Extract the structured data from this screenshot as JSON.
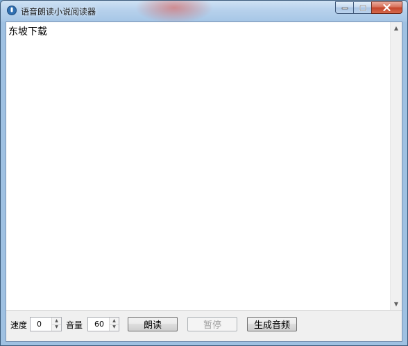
{
  "window": {
    "title": "语音朗读小说阅读器",
    "icon": "microphone-icon"
  },
  "editor": {
    "text": "东坡下载"
  },
  "controls": {
    "speed_label": "速度",
    "speed_value": "0",
    "volume_label": "音量",
    "volume_value": "60",
    "read_button": "朗读",
    "pause_button": "暂停",
    "pause_enabled": false,
    "generate_audio_button": "生成音频"
  },
  "colors": {
    "close_button": "#c4452b",
    "titlebar": "#b7d1ec"
  }
}
